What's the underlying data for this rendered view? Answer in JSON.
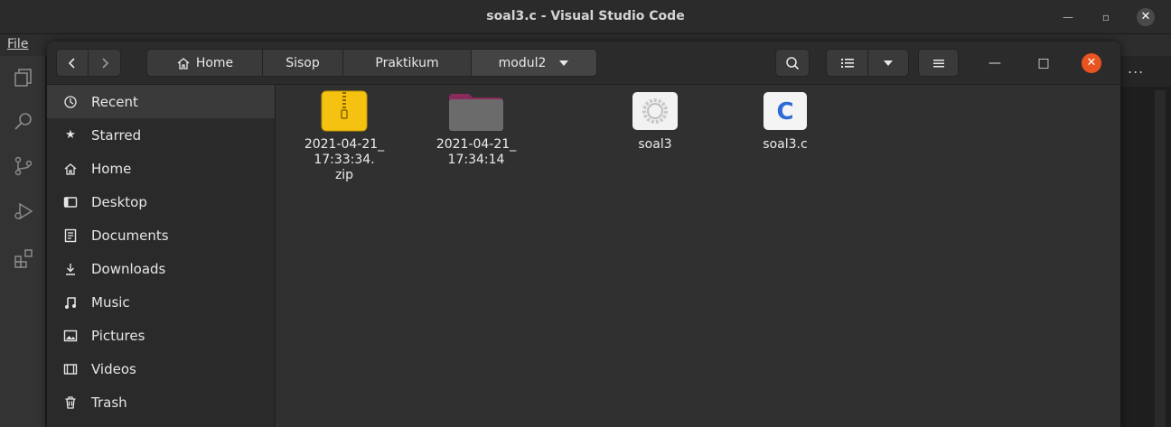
{
  "vscode": {
    "title": "soal3.c - Visual Studio Code",
    "menu_file": "File",
    "more": "..."
  },
  "nautilus": {
    "breadcrumbs": [
      "Home",
      "Sisop",
      "Praktikum",
      "modul2"
    ],
    "sidebar": [
      {
        "label": "Recent",
        "icon": "clock-icon",
        "active": true
      },
      {
        "label": "Starred",
        "icon": "star-icon"
      },
      {
        "label": "Home",
        "icon": "home-icon"
      },
      {
        "label": "Desktop",
        "icon": "desktop-icon"
      },
      {
        "label": "Documents",
        "icon": "documents-icon"
      },
      {
        "label": "Downloads",
        "icon": "download-icon"
      },
      {
        "label": "Music",
        "icon": "music-icon"
      },
      {
        "label": "Pictures",
        "icon": "pictures-icon"
      },
      {
        "label": "Videos",
        "icon": "videos-icon"
      },
      {
        "label": "Trash",
        "icon": "trash-icon"
      }
    ],
    "files": [
      {
        "name": "2021-04-21_\n17:33:34.\nzip",
        "type": "zip-archive-icon"
      },
      {
        "name": "2021-04-21_\n17:34:14",
        "type": "folder-icon"
      },
      {
        "name": "soal3",
        "type": "executable-icon"
      },
      {
        "name": "soal3.c",
        "type": "c-source-icon"
      }
    ],
    "colors": {
      "accent_close": "#e95420",
      "zip": "#f5c211",
      "folder_tab": "#8a2b5b"
    }
  }
}
